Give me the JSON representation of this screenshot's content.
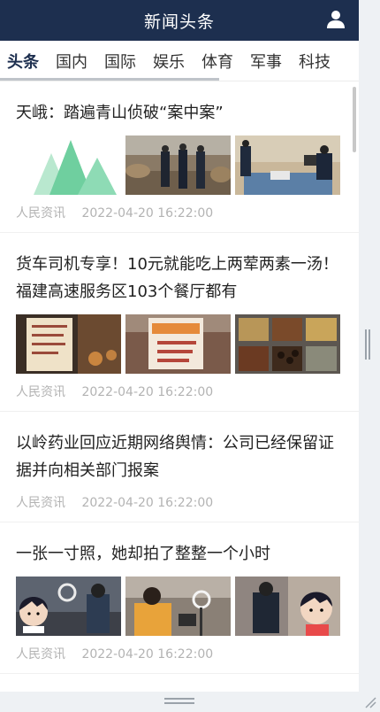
{
  "header": {
    "title": "新闻头条",
    "user_icon": "user-icon"
  },
  "tabs": [
    {
      "label": "头条",
      "active": true
    },
    {
      "label": "国内",
      "active": false
    },
    {
      "label": "国际",
      "active": false
    },
    {
      "label": "娱乐",
      "active": false
    },
    {
      "label": "体育",
      "active": false
    },
    {
      "label": "军事",
      "active": false
    },
    {
      "label": "科技",
      "active": false
    }
  ],
  "news": [
    {
      "title": "天峨：踏遍青山侦破“案中案”",
      "source": "人民资讯",
      "time": "2022-04-20 16:22:00",
      "images": [
        "forest-placeholder-image",
        "police-timber-yard-photo",
        "police-office-photo"
      ]
    },
    {
      "title": "货车司机专享！10元就能吃上两荤两素一汤！福建高速服务区103个餐厅都有",
      "source": "人民资讯",
      "time": "2022-04-20 16:22:00",
      "images": [
        "restaurant-notice-photo",
        "price-sign-photo",
        "food-trays-photo"
      ]
    },
    {
      "title": "以岭药业回应近期网络舆情：公司已经保留证据并向相关部门报案",
      "source": "人民资讯",
      "time": "2022-04-20 16:22:00",
      "images": []
    },
    {
      "title": "一张一寸照，她却拍了整整一个小时",
      "source": "人民资讯",
      "time": "2022-04-20 16:22:00",
      "images": [
        "photo-studio-photo-1",
        "photo-studio-photo-2",
        "photo-studio-photo-3"
      ]
    }
  ],
  "colors": {
    "header_bg": "#1d2f4f",
    "meta_text": "#b3b3b3",
    "title_text": "#222222"
  }
}
